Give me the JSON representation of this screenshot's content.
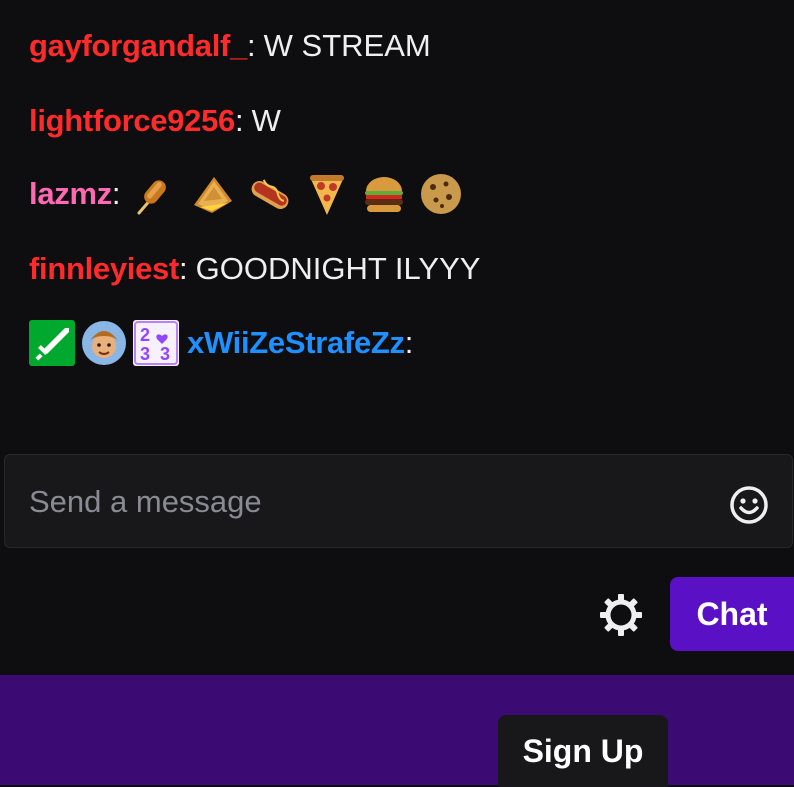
{
  "colors": {
    "background": "#0e0e10",
    "accent": "#5a11c6",
    "footer": "#3b0b73",
    "username_red": "#ff2a2a",
    "username_pink": "#ff69b4",
    "username_blue": "#1e90ff"
  },
  "chat": {
    "messages": [
      {
        "username": "gayforgandalf_",
        "color": "#ff2a2a",
        "colon": ":",
        "text": "W STREAM"
      },
      {
        "username": "lightforce9256",
        "color": "#ff2a2a",
        "colon": ":",
        "text": "W"
      },
      {
        "username": "lazmz",
        "color": "#ff69b4",
        "colon": ":",
        "emotes": [
          "corndog-emote",
          "grilled-cheese-emote",
          "hotdog-emote",
          "pizza-emote",
          "burger-emote",
          "cookie-emote"
        ]
      },
      {
        "username": "finnleyiest",
        "color": "#ff2a2a",
        "colon": ":",
        "text": "GOODNIGHT ILYYY"
      },
      {
        "username": "xWiiZeStrafeZz",
        "color": "#1e90ff",
        "colon": ":",
        "badges": [
          "sword-badge-icon",
          "avatar-badge-icon",
          "2023-badge-icon"
        ],
        "badge_text": [
          "2",
          "3",
          "2",
          "3"
        ]
      }
    ]
  },
  "input": {
    "placeholder": "Send a message",
    "value": ""
  },
  "buttons": {
    "chat_label": "Chat",
    "signup_label": "Sign Up"
  },
  "icons": {
    "emoji": "smiley-face-icon",
    "settings": "gear-icon"
  }
}
